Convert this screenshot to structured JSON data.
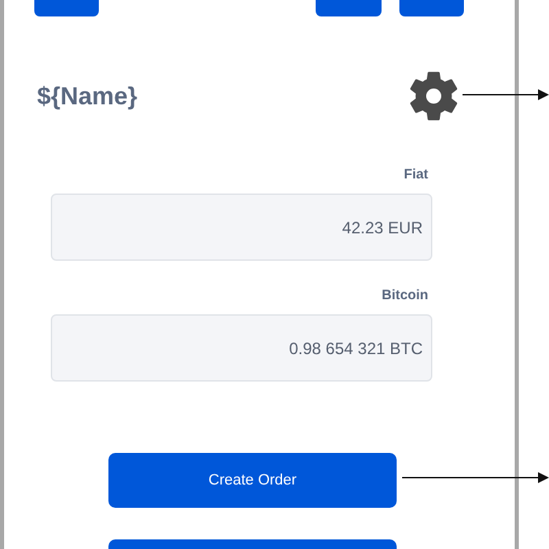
{
  "header": {
    "name": "${Name}"
  },
  "fields": [
    {
      "label": "Fiat",
      "value": "42.23 EUR"
    },
    {
      "label": "Bitcoin",
      "value": "0.98 654 321 BTC"
    }
  ],
  "buttons": [
    "Create Order"
  ]
}
